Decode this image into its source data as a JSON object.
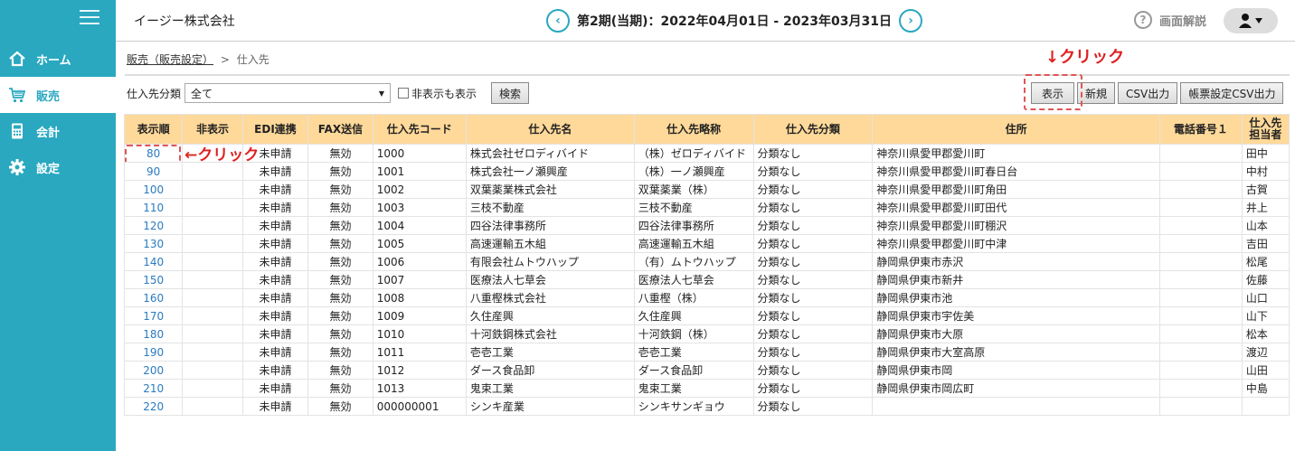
{
  "sidebar": {
    "items": [
      {
        "label": "ホーム",
        "icon": "home-icon"
      },
      {
        "label": "販売",
        "icon": "cart-icon"
      },
      {
        "label": "会計",
        "icon": "calculator-icon"
      },
      {
        "label": "設定",
        "icon": "gear-icon"
      }
    ],
    "active_index": 1
  },
  "header": {
    "company": "イージー株式会社",
    "period": "第2期(当期)：2022年04月01日 - 2023年03月31日",
    "prev_icon": "chevron-left-icon",
    "next_icon": "chevron-right-icon",
    "help_label": "画面解説",
    "user_icon": "user-icon"
  },
  "breadcrumb": {
    "parent": "販売（販売設定）",
    "separator": ">",
    "current": "仕入先"
  },
  "filter": {
    "category_label": "仕入先分類",
    "category_value": "全て",
    "hidden_label": "非表示も表示",
    "search_label": "検索"
  },
  "actions": {
    "display": "表示",
    "new": "新規",
    "csv": "CSV出力",
    "form_csv": "帳票設定CSV出力"
  },
  "annotations": {
    "top": "↓クリック",
    "row": "←クリック"
  },
  "colors": {
    "accent": "#29a8c0",
    "header_row": "#ffd99a",
    "annotation": "#e02020"
  },
  "table": {
    "headers": [
      "表示順",
      "非表示",
      "EDI連携",
      "FAX送信",
      "仕入先コード",
      "仕入先名",
      "仕入先略称",
      "仕入先分類",
      "住所",
      "電話番号１",
      "仕入先担当者"
    ],
    "rows": [
      [
        "80",
        "",
        "未申請",
        "無効",
        "1000",
        "株式会社ゼロディバイド",
        "（株）ゼロディバイド",
        "分類なし",
        "神奈川県愛甲郡愛川町",
        "",
        "田中"
      ],
      [
        "90",
        "",
        "未申請",
        "無効",
        "1001",
        "株式会社一ノ瀬興産",
        "（株）一ノ瀬興産",
        "分類なし",
        "神奈川県愛甲郡愛川町春日台",
        "",
        "中村"
      ],
      [
        "100",
        "",
        "未申請",
        "無効",
        "1002",
        "双葉薬業株式会社",
        "双葉薬業（株）",
        "分類なし",
        "神奈川県愛甲郡愛川町角田",
        "",
        "古賀"
      ],
      [
        "110",
        "",
        "未申請",
        "無効",
        "1003",
        "三枝不動産",
        "三枝不動産",
        "分類なし",
        "神奈川県愛甲郡愛川町田代",
        "",
        "井上"
      ],
      [
        "120",
        "",
        "未申請",
        "無効",
        "1004",
        "四谷法律事務所",
        "四谷法律事務所",
        "分類なし",
        "神奈川県愛甲郡愛川町棚沢",
        "",
        "山本"
      ],
      [
        "130",
        "",
        "未申請",
        "無効",
        "1005",
        "高速運輸五木組",
        "高速運輸五木組",
        "分類なし",
        "神奈川県愛甲郡愛川町中津",
        "",
        "吉田"
      ],
      [
        "140",
        "",
        "未申請",
        "無効",
        "1006",
        "有限会社ムトウハップ",
        "（有）ムトウハップ",
        "分類なし",
        "静岡県伊東市赤沢",
        "",
        "松尾"
      ],
      [
        "150",
        "",
        "未申請",
        "無効",
        "1007",
        "医療法人七草会",
        "医療法人七草会",
        "分類なし",
        "静岡県伊東市新井",
        "",
        "佐藤"
      ],
      [
        "160",
        "",
        "未申請",
        "無効",
        "1008",
        "八重樫株式会社",
        "八重樫（株）",
        "分類なし",
        "静岡県伊東市池",
        "",
        "山口"
      ],
      [
        "170",
        "",
        "未申請",
        "無効",
        "1009",
        "久住産興",
        "久住産興",
        "分類なし",
        "静岡県伊東市宇佐美",
        "",
        "山下"
      ],
      [
        "180",
        "",
        "未申請",
        "無効",
        "1010",
        "十河鉄鋼株式会社",
        "十河鉄鋼（株）",
        "分類なし",
        "静岡県伊東市大原",
        "",
        "松本"
      ],
      [
        "190",
        "",
        "未申請",
        "無効",
        "1011",
        "壱壱工業",
        "壱壱工業",
        "分類なし",
        "静岡県伊東市大室高原",
        "",
        "渡辺"
      ],
      [
        "200",
        "",
        "未申請",
        "無効",
        "1012",
        "ダース食品卸",
        "ダース食品卸",
        "分類なし",
        "静岡県伊東市岡",
        "",
        "山田"
      ],
      [
        "210",
        "",
        "未申請",
        "無効",
        "1013",
        "鬼束工業",
        "鬼束工業",
        "分類なし",
        "静岡県伊東市岡広町",
        "",
        "中島"
      ],
      [
        "220",
        "",
        "未申請",
        "無効",
        "000000001",
        "シンキ産業",
        "シンキサンギョウ",
        "分類なし",
        "",
        "",
        ""
      ]
    ]
  }
}
